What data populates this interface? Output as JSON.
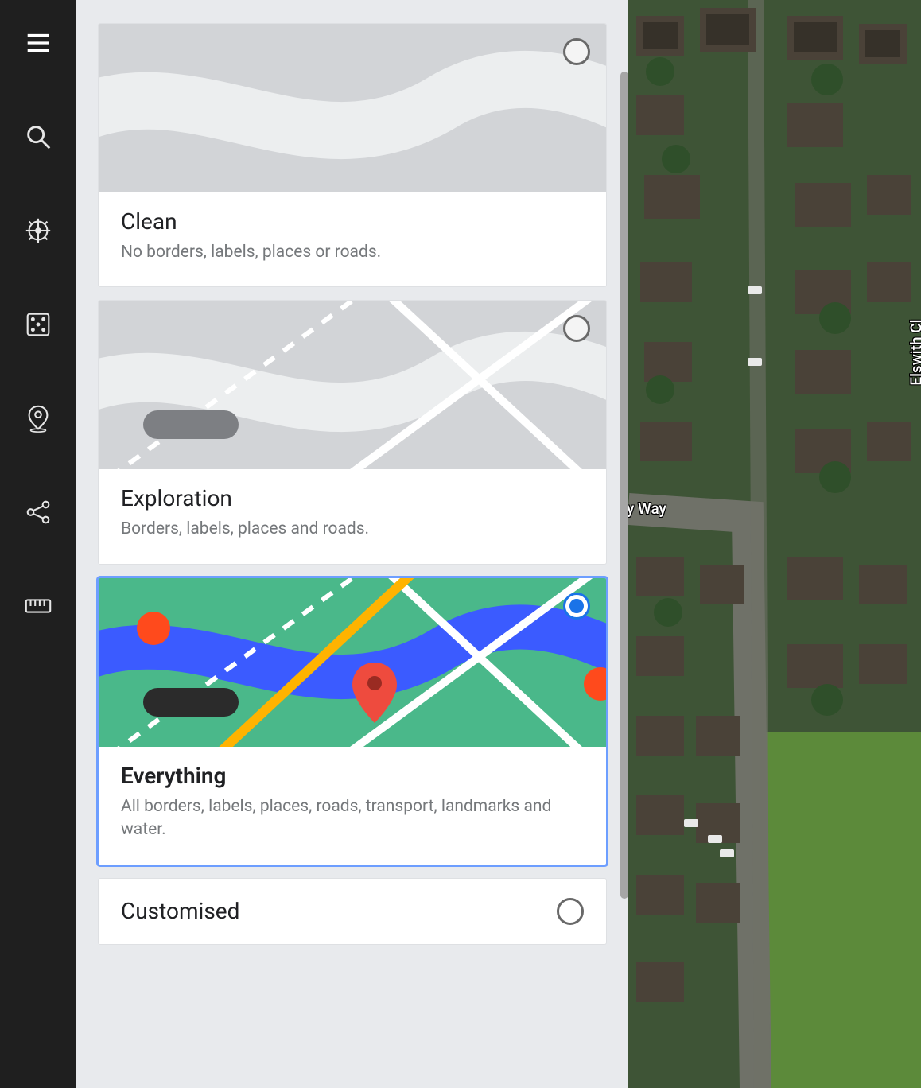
{
  "nav": {
    "items": [
      {
        "name": "menu-icon"
      },
      {
        "name": "search-icon"
      },
      {
        "name": "wheel-icon"
      },
      {
        "name": "dice-icon"
      },
      {
        "name": "location-pin-icon"
      },
      {
        "name": "share-icon"
      },
      {
        "name": "ruler-icon"
      }
    ]
  },
  "styles": [
    {
      "id": "clean",
      "title": "Clean",
      "description": "No borders, labels, places or roads.",
      "selected": false
    },
    {
      "id": "exploration",
      "title": "Exploration",
      "description": "Borders, labels, places and roads.",
      "selected": false
    },
    {
      "id": "everything",
      "title": "Everything",
      "description": "All borders, labels, places, roads, transport, landmarks and water.",
      "selected": true
    },
    {
      "id": "customised",
      "title": "Customised",
      "description": "",
      "selected": false
    }
  ],
  "map": {
    "labels": {
      "elswith": "Elswith Cl",
      "way": "y Way"
    }
  }
}
